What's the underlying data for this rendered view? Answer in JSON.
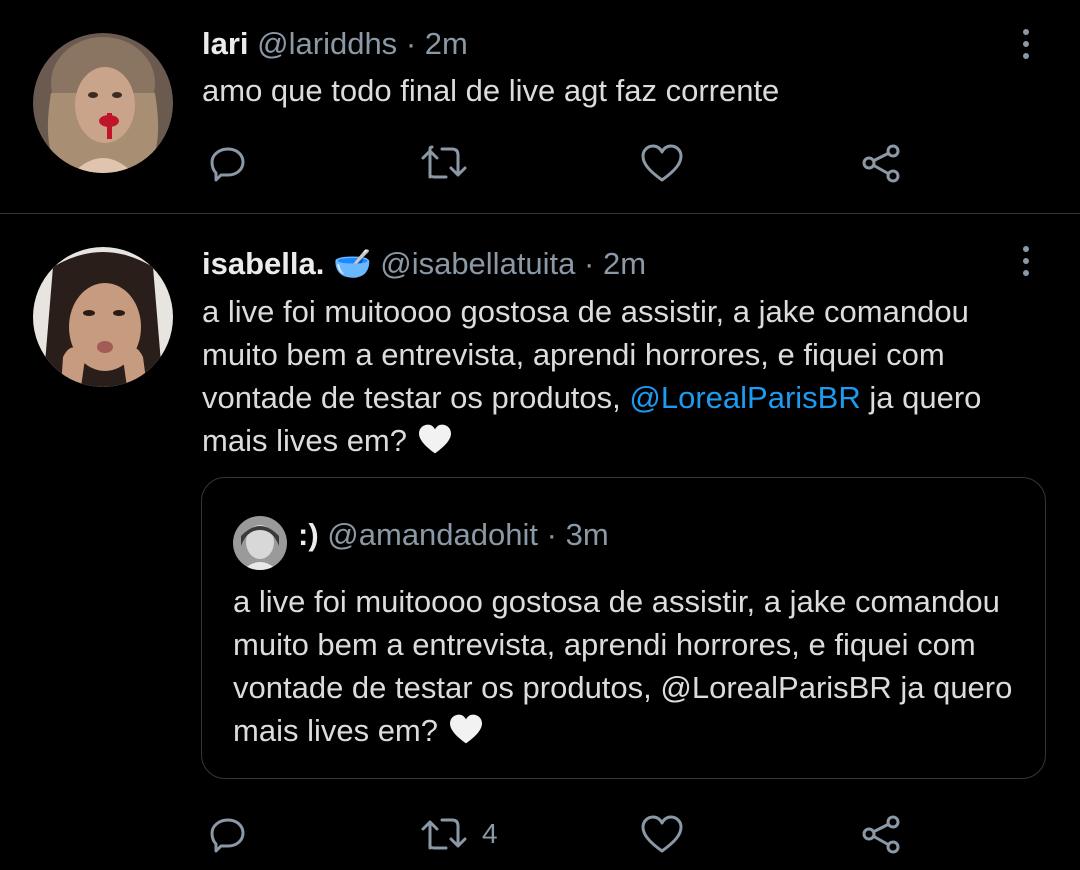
{
  "tweets": [
    {
      "name": "lari",
      "handle": "@lariddhs",
      "separator": "·",
      "time": "2m",
      "text": "amo que todo final de live agt faz corrente",
      "actions": {
        "retweet_count": ""
      }
    },
    {
      "name": "isabella.",
      "name_emoji": "🥣",
      "handle": "@isabellatuita",
      "separator": "·",
      "time": "2m",
      "text_before": "a live foi muitoooo gostosa de assistir, a jake comandou muito bem a entrevista, aprendi horrores, e fiquei com vontade de testar os produtos,",
      "mention": "@LorealParisBR",
      "text_after": "ja quero mais lives em?",
      "actions": {
        "retweet_count": "4"
      },
      "quote": {
        "name": ":)",
        "handle": "@amandadohit",
        "separator": "·",
        "time": "3m",
        "text": "a live foi muitoooo gostosa de assistir, a jake comandou muito bem a entrevista, aprendi horrores, e fiquei com vontade de testar os produtos, @LorealParisBR ja quero mais lives em?"
      }
    }
  ],
  "icons": {
    "reply": "reply-icon",
    "retweet": "retweet-icon",
    "like": "heart-icon",
    "share": "share-icon",
    "more": "more-vertical-icon"
  },
  "colors": {
    "background": "#000000",
    "text": "#d9d9d9",
    "secondary": "#8b98a5",
    "link": "#1d9bf0",
    "divider": "#2f3336"
  }
}
